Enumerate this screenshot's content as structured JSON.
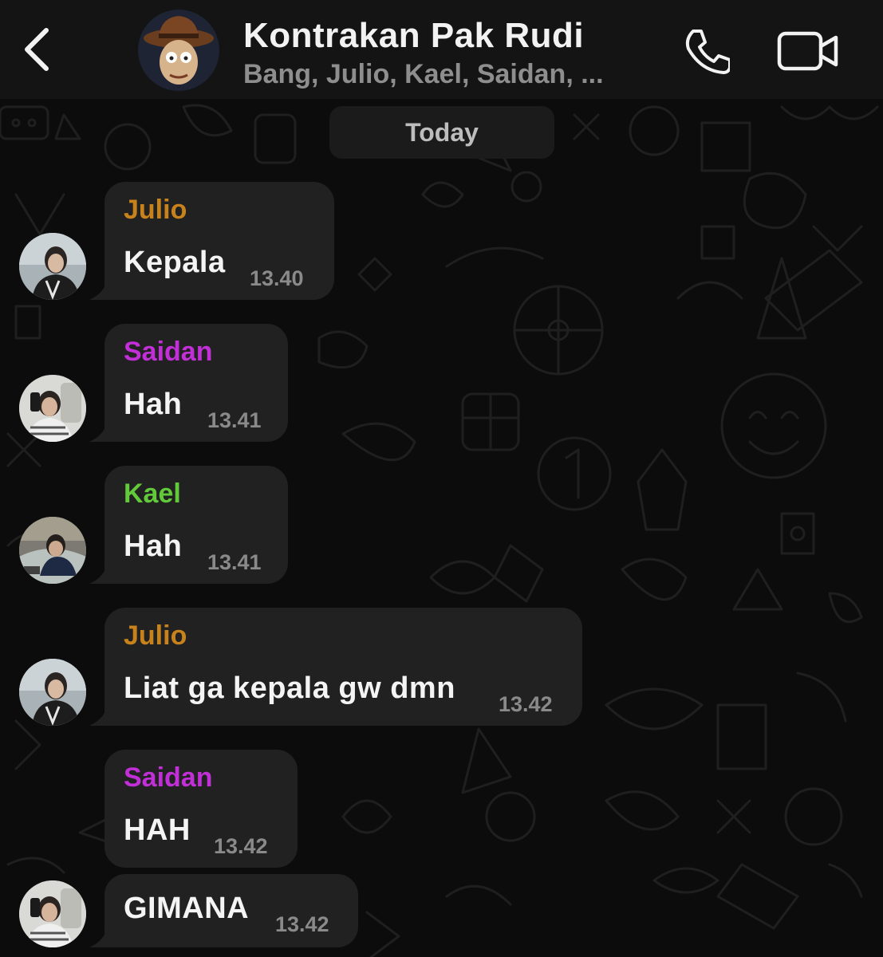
{
  "header": {
    "title": "Kontrakan Pak Rudi",
    "subtitle": "Bang, Julio, Kael, Saidan, ...",
    "back_icon": "chevron-left-icon",
    "call_icon": "phone-icon",
    "video_icon": "video-camera-icon"
  },
  "date_chip": "Today",
  "colors": {
    "background": "#0c0c0c",
    "header": "#141414",
    "bubble": "#212121",
    "julio": "#c8821c",
    "saidan": "#c12fd6",
    "kael": "#62c93a",
    "timestamp": "#8a8a8a"
  },
  "messages": [
    {
      "sender": "Julio",
      "text": "Kepala",
      "time": "13.40"
    },
    {
      "sender": "Saidan",
      "text": "Hah",
      "time": "13.41"
    },
    {
      "sender": "Kael",
      "text": "Hah",
      "time": "13.41"
    },
    {
      "sender": "Julio",
      "text": "Liat ga kepala gw dmn",
      "time": "13.42"
    },
    {
      "sender": "Saidan",
      "text": "HAH",
      "time": "13.42"
    },
    {
      "sender": "",
      "text": "GIMANA",
      "time": "13.42"
    }
  ]
}
